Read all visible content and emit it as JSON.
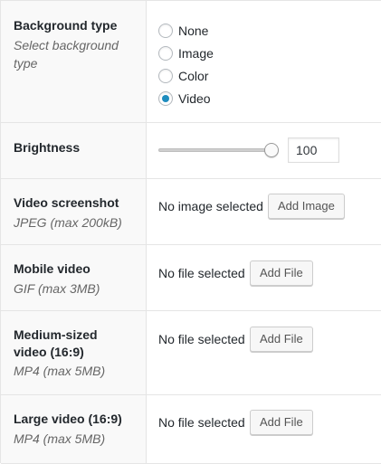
{
  "rows": {
    "background_type": {
      "title": "Background type",
      "desc": "Select background type",
      "options": [
        {
          "label": "None",
          "checked": false
        },
        {
          "label": "Image",
          "checked": false
        },
        {
          "label": "Color",
          "checked": false
        },
        {
          "label": "Video",
          "checked": true
        }
      ]
    },
    "brightness": {
      "title": "Brightness",
      "value": "100"
    },
    "video_screenshot": {
      "title": "Video screenshot",
      "desc": "JPEG (max 200kB)",
      "status": "No image selected",
      "button": "Add Image"
    },
    "mobile_video": {
      "title": "Mobile video",
      "desc": "GIF (max 3MB)",
      "status": "No file selected",
      "button": "Add File"
    },
    "medium_video": {
      "title": "Medium-sized video (16:9)",
      "desc": "MP4 (max 5MB)",
      "status": "No file selected",
      "button": "Add File"
    },
    "large_video": {
      "title": "Large video (16:9)",
      "desc": "MP4 (max 5MB)",
      "status": "No file selected",
      "button": "Add File"
    }
  },
  "colors": {
    "radio_checked": "#1e8cbe",
    "label_bg": "#f9f9f9"
  }
}
